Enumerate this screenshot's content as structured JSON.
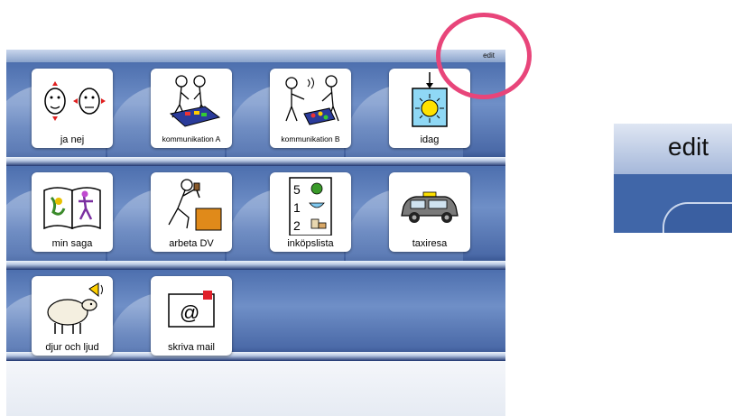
{
  "toolbar": {
    "edit_label": "edit"
  },
  "tiles": [
    {
      "label": "ja nej",
      "icon": "faces-yes-no-icon"
    },
    {
      "label": "kommunikation A",
      "icon": "communication-a-icon"
    },
    {
      "label": "kommunikation B",
      "icon": "communication-b-icon"
    },
    {
      "label": "idag",
      "icon": "sun-today-icon"
    },
    {
      "label": "min saga",
      "icon": "storybook-icon"
    },
    {
      "label": "arbeta DV",
      "icon": "work-icon"
    },
    {
      "label": "inköpslista",
      "icon": "shopping-list-icon"
    },
    {
      "label": "taxiresa",
      "icon": "taxi-icon"
    },
    {
      "label": "djur och ljud",
      "icon": "sheep-sound-icon"
    },
    {
      "label": "skriva mail",
      "icon": "email-icon"
    }
  ],
  "zoom": {
    "edit_label": "edit"
  },
  "colors": {
    "highlight_circle": "#e8457a",
    "shelf_blue": "#3a5fa1"
  }
}
